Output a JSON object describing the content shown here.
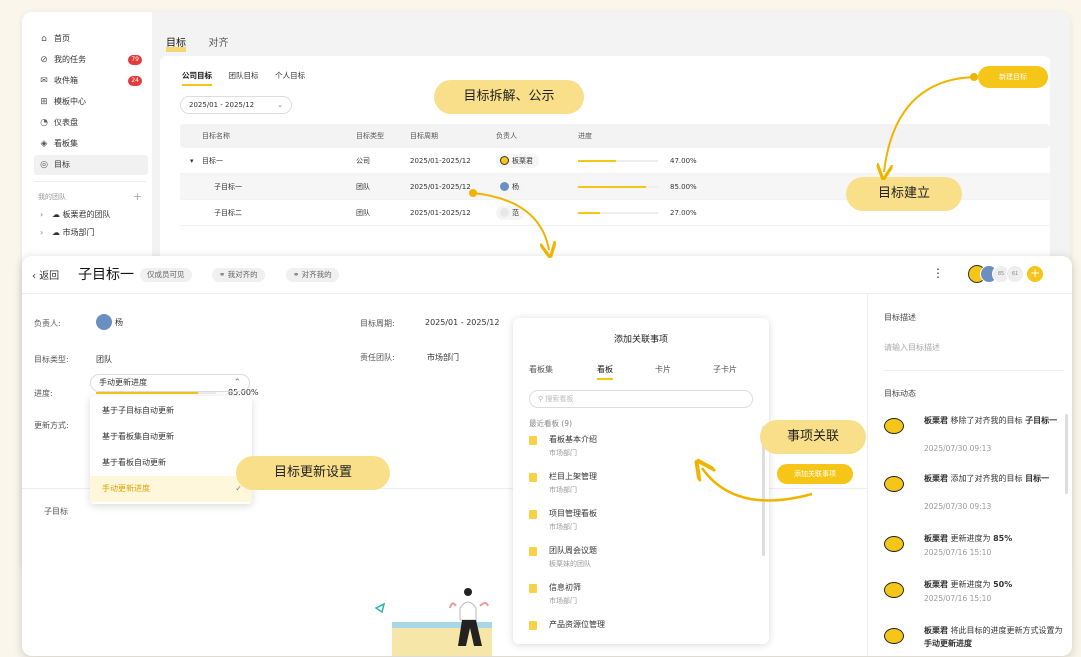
{
  "sidebar": {
    "items": [
      {
        "label": "首页",
        "icon": "home-icon",
        "glyph": "⌂"
      },
      {
        "label": "我的任务",
        "icon": "check-circle-icon",
        "glyph": "⊘",
        "count": "79"
      },
      {
        "label": "收件箱",
        "icon": "mail-icon",
        "glyph": "✉",
        "count": "24"
      },
      {
        "label": "模板中心",
        "icon": "grid-icon",
        "glyph": "⊞"
      },
      {
        "label": "仪表盘",
        "icon": "dashboard-icon",
        "glyph": "◔"
      },
      {
        "label": "看板集",
        "icon": "layers-icon",
        "glyph": "◈"
      },
      {
        "label": "目标",
        "icon": "target-icon",
        "glyph": "◎"
      }
    ],
    "team_header": "我的团队",
    "teams": [
      "板栗君的团队",
      "市场部门"
    ]
  },
  "main": {
    "tabs": [
      "目标",
      "对齐"
    ],
    "subtabs": [
      "公司目标",
      "团队目标",
      "个人目标"
    ],
    "range": "2025/01 - 2025/12",
    "new_button": "新建目标",
    "table": {
      "headers": [
        "目标名称",
        "目标类型",
        "目标周期",
        "负责人",
        "进度"
      ],
      "rows": [
        {
          "name": "目标一",
          "type": "公司",
          "period": "2025/01-2025/12",
          "owner": "板栗君",
          "progress": "47.00%",
          "pct": 0.47
        },
        {
          "name": "子目标一",
          "type": "团队",
          "period": "2025/01-2025/12",
          "owner": "杨",
          "progress": "85.00%",
          "pct": 0.85
        },
        {
          "name": "子目标二",
          "type": "团队",
          "period": "2025/01-2025/12",
          "owner": "范",
          "progress": "27.00%",
          "pct": 0.27
        }
      ]
    }
  },
  "detail": {
    "back": "返回",
    "title": "子目标一",
    "pills": [
      "仅成员可见",
      "我对齐的",
      "对齐我的"
    ],
    "owner_label": "负责人:",
    "owner": "杨",
    "type_label": "目标类型:",
    "type": "团队",
    "progress_label": "进度:",
    "progress": "85.00%",
    "progress_pct": 0.85,
    "update_label": "更新方式:",
    "update_value": "手动更新进度",
    "update_options": [
      "基于子目标自动更新",
      "基于看板集自动更新",
      "基于看板自动更新",
      "手动更新进度"
    ],
    "period_label": "目标周期:",
    "period": "2025/01 - 2025/12",
    "team_label": "责任团队:",
    "team": "市场部门",
    "sub_goal_label": "子目标",
    "add_assoc_button": "添加关联事项",
    "avatar_counts": [
      "85",
      "61"
    ]
  },
  "assoc_panel": {
    "title": "添加关联事项",
    "tabs": [
      "看板集",
      "看板",
      "卡片",
      "子卡片"
    ],
    "search_placeholder": "搜索看板",
    "section": "最近看板 (9)",
    "items": [
      {
        "name": "看板基本介绍",
        "team": "市场部门"
      },
      {
        "name": "栏目上架管理",
        "team": "市场部门"
      },
      {
        "name": "项目管理看板",
        "team": "市场部门"
      },
      {
        "name": "团队周会议题",
        "team": "板栗妹的团队"
      },
      {
        "name": "信息初筛",
        "team": "市场部门"
      },
      {
        "name": "产品资源位管理",
        "team": ""
      }
    ]
  },
  "right_panel": {
    "desc_label": "目标描述",
    "desc_placeholder": "请输入目标描述",
    "activity_label": "目标动态",
    "activities": [
      {
        "user": "板栗君",
        "action": "移除了对齐我的目标",
        "obj": "子目标一",
        "time": "2025/07/30 09:13"
      },
      {
        "user": "板栗君",
        "action": "添加了对齐我的目标",
        "obj": "目标一",
        "time": "2025/07/30 09:13"
      },
      {
        "user": "板栗君",
        "action": "更新进度为",
        "obj": "85%",
        "time": "2025/07/16 15:10"
      },
      {
        "user": "板栗君",
        "action": "更新进度为",
        "obj": "50%",
        "time": "2025/07/16 15:10"
      },
      {
        "user": "板栗君",
        "action": "将此目标的进度更新方式设置为",
        "obj": "手动更新进度",
        "time": ""
      }
    ]
  },
  "callouts": {
    "decompose": "目标拆解、公示",
    "create": "目标建立",
    "update": "目标更新设置",
    "assoc": "事项关联"
  },
  "colors": {
    "accent": "#f5c518",
    "badge": "#e23b3b",
    "callout": "#f9df8a"
  }
}
